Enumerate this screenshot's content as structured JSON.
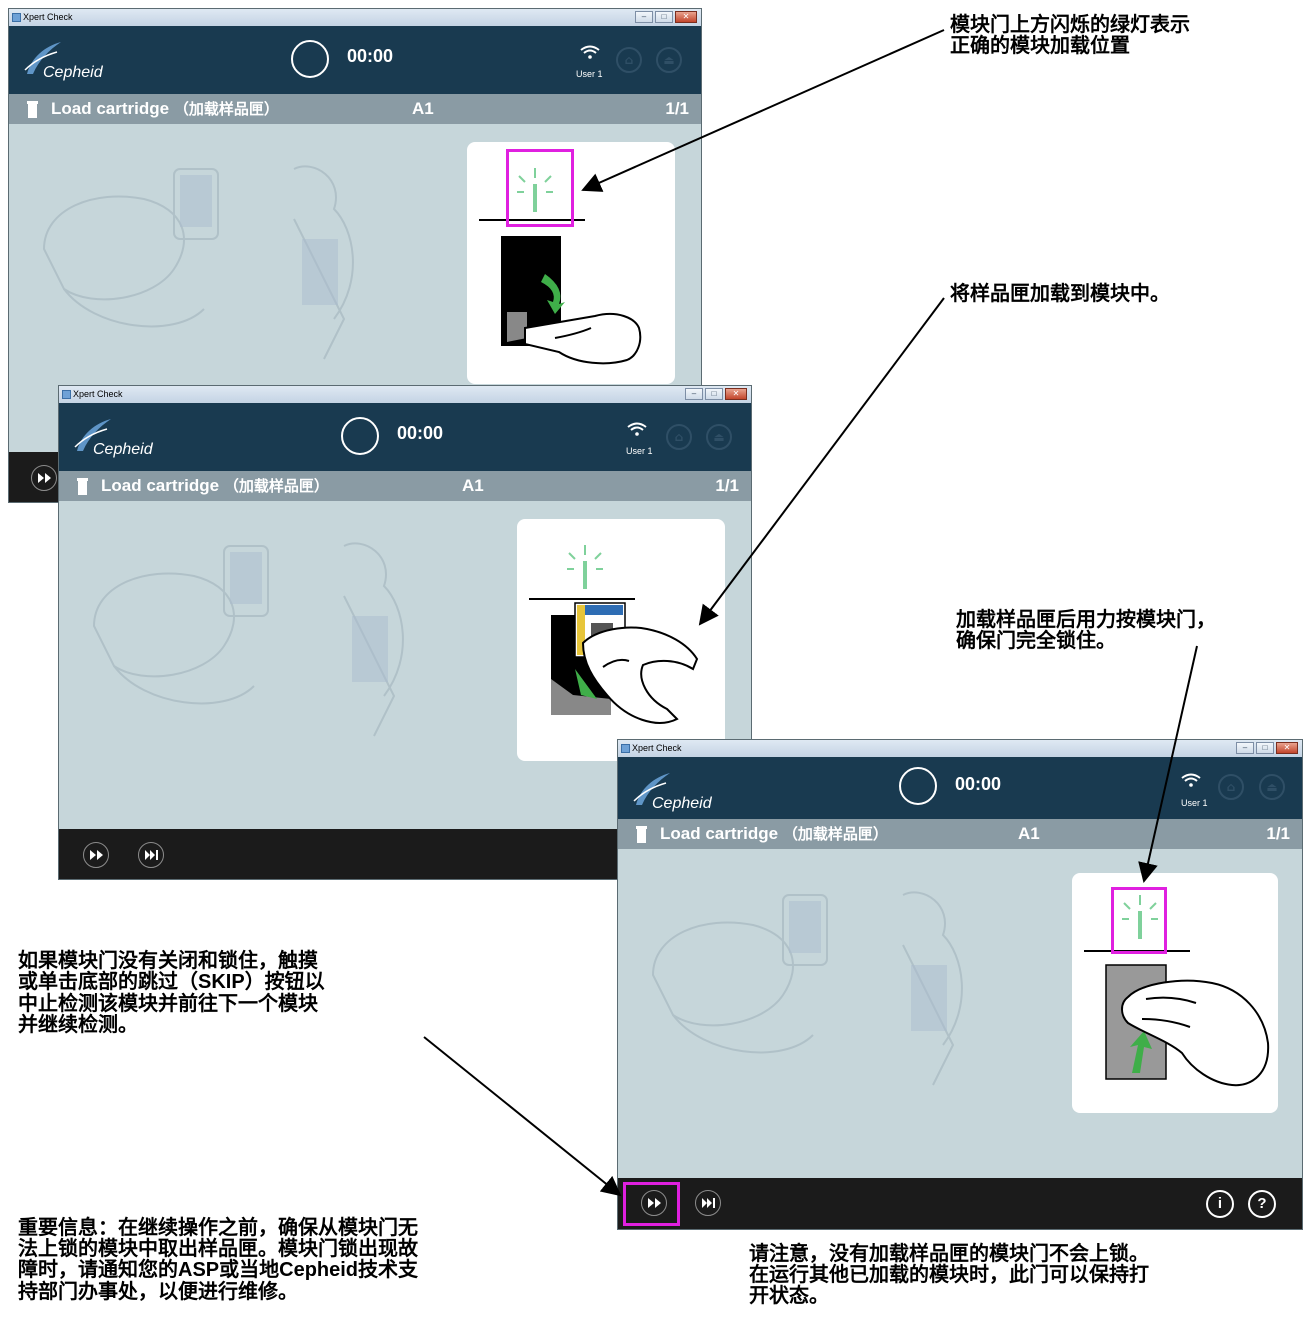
{
  "window": {
    "title": "Xpert Check",
    "brand": "Cepheid",
    "timer": "00:00",
    "user": "User 1",
    "step_label": "Load cartridge",
    "step_label_cn": "（加载样品匣）",
    "module_position": "A1",
    "step_count": "1/1",
    "info_button": "i",
    "help_button": "?"
  },
  "icons": {
    "wifi": "wifi-icon",
    "cartridge": "cartridge-icon",
    "skip": "skip-icon",
    "skip_all": "skip-to-end-icon",
    "status_light": "blinking-light-icon"
  },
  "callouts": {
    "c1": [
      "模块门上方闪烁的绿灯表示",
      "正确的模块加载位置"
    ],
    "c2": [
      "将样品匣加载到模块中。"
    ],
    "c3": [
      "加载样品匣后用力按模块门，",
      "确保门完全锁住。"
    ],
    "c4_l1": "如果模块门没有关闭和锁住，触摸",
    "c4_l2a": "或单击底部的跳过（",
    "c4_l2b": "SKIP",
    "c4_l2c": "）按钮以",
    "c4_l3": "中止检测该模块并前往下一个模块",
    "c4_l4": "并继续检测。",
    "c5_l1": "重要信息：在继续操作之前，确保从模块门无",
    "c5_l2": "法上锁的模块中取出样品匣。模块门锁出现故",
    "c5_l3a": "障时，请通知您的",
    "c5_l3b": "ASP",
    "c5_l3c": "或当地",
    "c5_l3d": "Cepheid",
    "c5_l3e": "技术支",
    "c5_l4": "持部门办事处，以便进行维修。",
    "c6": [
      "请注意，没有加载样品匣的模块门不会上锁。",
      "在运行其他已加载的模块时，此门可以保持打",
      "开状态。"
    ]
  },
  "colors": {
    "header_bg": "#193a50",
    "statusbar_bg": "#8a9ba4",
    "content_bg": "#c6d6da",
    "footer_bg": "#1b1b1b",
    "highlight": "#e020e0",
    "indicator_green": "#7fd19b",
    "arrow_green": "#3fae49"
  }
}
